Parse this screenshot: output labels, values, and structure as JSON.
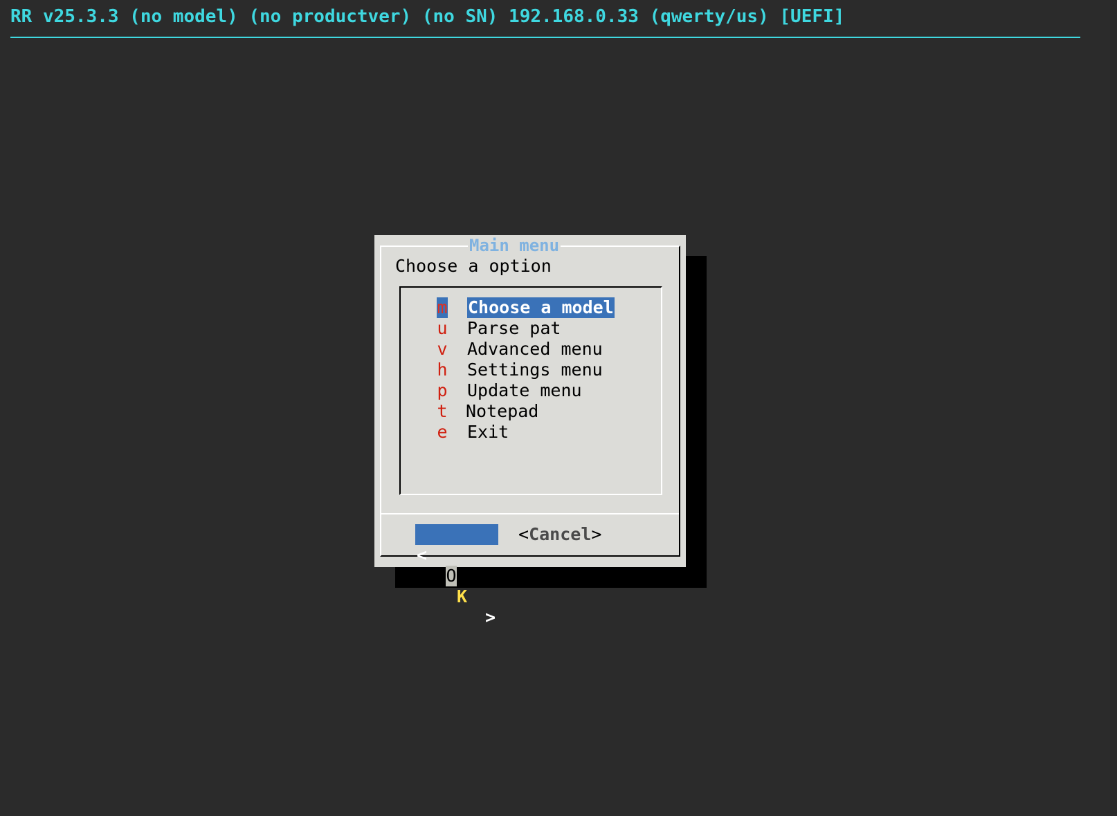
{
  "backtitle": "RR v25.3.3 (no model) (no productver) (no SN) 192.168.0.33 (qwerty/us) [UEFI]",
  "dialog": {
    "title": "Main menu",
    "prompt": "Choose a option",
    "items": [
      {
        "tag": "m",
        "label": "Choose a model",
        "selected": true
      },
      {
        "tag": "u",
        "label": "Parse pat",
        "selected": false
      },
      {
        "tag": "v",
        "label": "Advanced menu",
        "selected": false
      },
      {
        "tag": "h",
        "label": "Settings menu",
        "selected": false
      },
      {
        "tag": "p",
        "label": "Update menu",
        "selected": false
      },
      {
        "tag": "t",
        "label": "Notepad",
        "selected": false
      },
      {
        "tag": "e",
        "label": "Exit",
        "selected": false
      }
    ],
    "buttons": {
      "ok": {
        "open": "<",
        "first": "O",
        "rest": "K",
        "close": ">"
      },
      "cancel": {
        "open": "<",
        "label": "Cancel",
        "close": ">"
      }
    }
  },
  "colors": {
    "background": "#2b2b2b",
    "backtitle": "#3fd8e0",
    "dialog_bg": "#dcdcd8",
    "title": "#7fb2e0",
    "selection": "#3a72b8",
    "hotkey": "#d02010",
    "ok_accent": "#ffe04a"
  }
}
